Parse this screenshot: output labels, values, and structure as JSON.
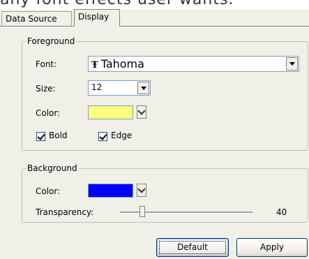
{
  "header_partial_text": "any font effects user wants.",
  "tabs": [
    {
      "label": "Data Source",
      "active": false
    },
    {
      "label": "Display",
      "active": true
    }
  ],
  "foreground": {
    "legend": "Foreground",
    "font_label": "Font:",
    "font_value": "Tahoma",
    "font_type_icon": "truetype-font-icon",
    "size_label": "Size:",
    "size_value": "12",
    "color_label": "Color:",
    "color_value": "#ffff80",
    "bold_label": "Bold",
    "bold_checked": true,
    "edge_label": "Edge",
    "edge_checked": true
  },
  "background": {
    "legend": "Background",
    "color_label": "Color:",
    "color_value": "#0000ff",
    "transparency_label": "Transparency:",
    "transparency_value": "40"
  },
  "buttons": {
    "default_label": "Default",
    "apply_label": "Apply"
  }
}
